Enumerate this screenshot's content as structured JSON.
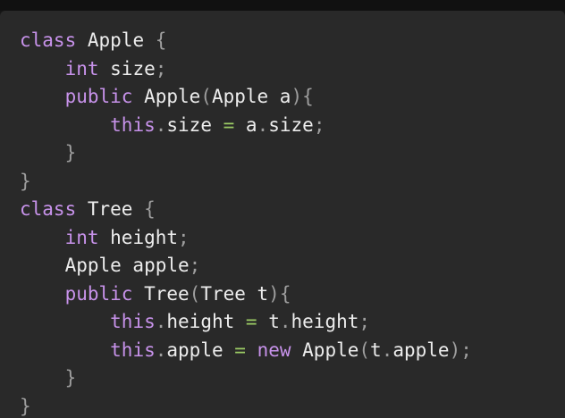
{
  "colors": {
    "background": "#292929",
    "keyword": "#c792ea",
    "identifier": "#ededed",
    "punctuation": "#9e9e9e",
    "operator": "#9ccc65"
  },
  "code": {
    "language": "java",
    "lines": [
      [
        {
          "t": "class",
          "c": "kw"
        },
        {
          "t": " ",
          "c": "id"
        },
        {
          "t": "Apple",
          "c": "id"
        },
        {
          "t": " ",
          "c": "id"
        },
        {
          "t": "{",
          "c": "pn"
        }
      ],
      [
        {
          "t": "    ",
          "c": "id"
        },
        {
          "t": "int",
          "c": "kw"
        },
        {
          "t": " size",
          "c": "id"
        },
        {
          "t": ";",
          "c": "pn"
        }
      ],
      [
        {
          "t": "    ",
          "c": "id"
        },
        {
          "t": "public",
          "c": "kw"
        },
        {
          "t": " Apple",
          "c": "id"
        },
        {
          "t": "(",
          "c": "pn"
        },
        {
          "t": "Apple a",
          "c": "id"
        },
        {
          "t": "){",
          "c": "pn"
        }
      ],
      [
        {
          "t": "        ",
          "c": "id"
        },
        {
          "t": "this",
          "c": "kw"
        },
        {
          "t": ".",
          "c": "pn"
        },
        {
          "t": "size",
          "c": "id"
        },
        {
          "t": " ",
          "c": "id"
        },
        {
          "t": "=",
          "c": "op"
        },
        {
          "t": " a",
          "c": "id"
        },
        {
          "t": ".",
          "c": "pn"
        },
        {
          "t": "size",
          "c": "id"
        },
        {
          "t": ";",
          "c": "pn"
        }
      ],
      [
        {
          "t": "    ",
          "c": "id"
        },
        {
          "t": "}",
          "c": "pn"
        }
      ],
      [
        {
          "t": "}",
          "c": "pn"
        }
      ],
      [
        {
          "t": "class",
          "c": "kw"
        },
        {
          "t": " Tree ",
          "c": "id"
        },
        {
          "t": "{",
          "c": "pn"
        }
      ],
      [
        {
          "t": "    ",
          "c": "id"
        },
        {
          "t": "int",
          "c": "kw"
        },
        {
          "t": " height",
          "c": "id"
        },
        {
          "t": ";",
          "c": "pn"
        }
      ],
      [
        {
          "t": "    Apple apple",
          "c": "id"
        },
        {
          "t": ";",
          "c": "pn"
        }
      ],
      [
        {
          "t": "    ",
          "c": "id"
        },
        {
          "t": "public",
          "c": "kw"
        },
        {
          "t": " Tree",
          "c": "id"
        },
        {
          "t": "(",
          "c": "pn"
        },
        {
          "t": "Tree t",
          "c": "id"
        },
        {
          "t": "){",
          "c": "pn"
        }
      ],
      [
        {
          "t": "        ",
          "c": "id"
        },
        {
          "t": "this",
          "c": "kw"
        },
        {
          "t": ".",
          "c": "pn"
        },
        {
          "t": "height",
          "c": "id"
        },
        {
          "t": " ",
          "c": "id"
        },
        {
          "t": "=",
          "c": "op"
        },
        {
          "t": " t",
          "c": "id"
        },
        {
          "t": ".",
          "c": "pn"
        },
        {
          "t": "height",
          "c": "id"
        },
        {
          "t": ";",
          "c": "pn"
        }
      ],
      [
        {
          "t": "        ",
          "c": "id"
        },
        {
          "t": "this",
          "c": "kw"
        },
        {
          "t": ".",
          "c": "pn"
        },
        {
          "t": "apple",
          "c": "id"
        },
        {
          "t": " ",
          "c": "id"
        },
        {
          "t": "=",
          "c": "op"
        },
        {
          "t": " ",
          "c": "id"
        },
        {
          "t": "new",
          "c": "kw"
        },
        {
          "t": " Apple",
          "c": "id"
        },
        {
          "t": "(",
          "c": "pn"
        },
        {
          "t": "t",
          "c": "id"
        },
        {
          "t": ".",
          "c": "pn"
        },
        {
          "t": "apple",
          "c": "id"
        },
        {
          "t": ");",
          "c": "pn"
        }
      ],
      [
        {
          "t": "    ",
          "c": "id"
        },
        {
          "t": "}",
          "c": "pn"
        }
      ],
      [
        {
          "t": "}",
          "c": "pn"
        }
      ]
    ]
  }
}
